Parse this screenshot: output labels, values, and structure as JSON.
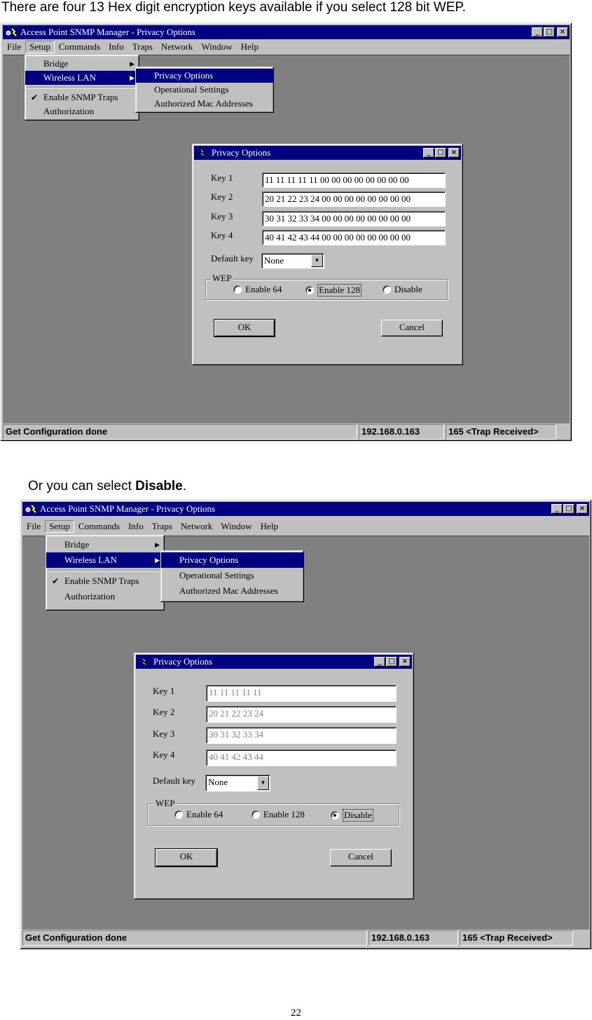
{
  "para1": "There are four 13 Hex digit encryption keys available if you select 128 bit WEP.",
  "para2_prefix": "Or you can select ",
  "para2_bold": "Disable",
  "para2_suffix": ".",
  "page_number": "22",
  "app": {
    "title": "Access Point SNMP Manager -  Privacy Options",
    "menubar": [
      "File",
      "Setup",
      "Commands",
      "Info",
      "Traps",
      "Network",
      "Window",
      "Help"
    ],
    "setup_menu": [
      "Bridge",
      "Wireless LAN",
      "Enable SNMP Traps",
      "Authorization"
    ],
    "wireless_submenu": [
      "Privacy Options",
      "Operational Settings",
      "Authorized Mac Addresses"
    ],
    "status": [
      "Get Configuration done",
      "192.168.0.163",
      "165 <Trap Received>"
    ]
  },
  "dialog": {
    "title": "Privacy Options",
    "key_labels": [
      "Key 1",
      "Key 2",
      "Key 3",
      "Key 4"
    ],
    "default_key_label": "Default key",
    "default_key_value": "None",
    "wep_label": "WEP",
    "wep_options": [
      "Enable 64",
      "Enable 128",
      "Disable"
    ],
    "ok_label": "OK",
    "cancel_label": "Cancel"
  },
  "screen1": {
    "keys": [
      "11 11 11 11 11 00 00 00 00 00 00 00 00",
      "20 21 22 23 24 00 00 00 00 00 00 00 00",
      "30 31 32 33 34 00 00 00 00 00 00 00 00",
      "40 41 42 43 44 00 00 00 00 00 00 00 00"
    ],
    "wep_selected": "Enable 128"
  },
  "screen2": {
    "keys": [
      "11 11 11 11 11",
      "20 21 22 23 24",
      "30 31 32 33 34",
      "40 41 42 43 44"
    ],
    "wep_selected": "Disable"
  }
}
